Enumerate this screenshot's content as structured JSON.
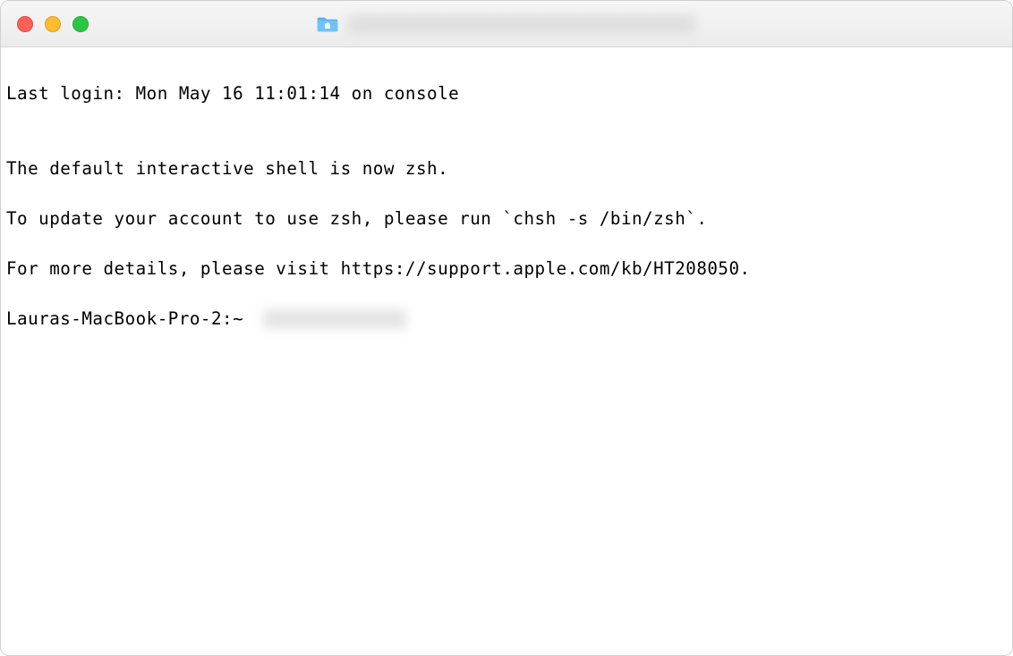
{
  "terminal": {
    "last_login": "Last login: Mon May 16 11:01:14 on console",
    "blank_line": "",
    "zsh_notice_line1": "The default interactive shell is now zsh.",
    "zsh_notice_line2": "To update your account to use zsh, please run `chsh -s /bin/zsh`.",
    "zsh_notice_line3": "For more details, please visit https://support.apple.com/kb/HT208050.",
    "prompt": "Lauras-MacBook-Pro-2:~ "
  }
}
